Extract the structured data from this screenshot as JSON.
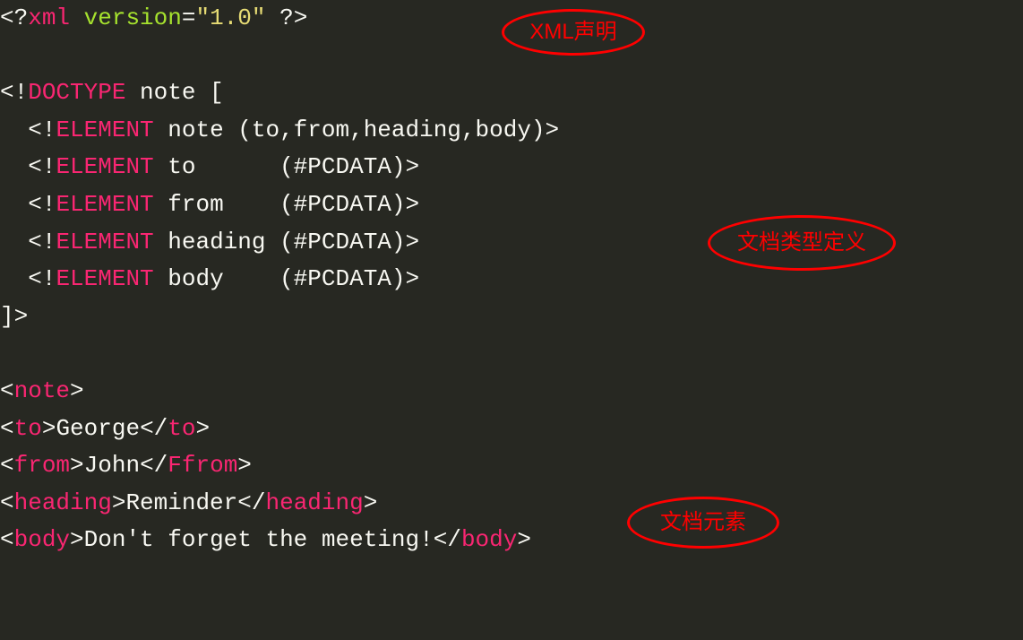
{
  "code": {
    "line1": {
      "open": "<?",
      "keyword": "xml",
      "attr": "version",
      "eq": "=",
      "value": "\"1.0\"",
      "close": " ?>"
    },
    "line2": {
      "open": "<!",
      "keyword": "DOCTYPE",
      "name": " note [",
      "full": "<!DOCTYPE note ["
    },
    "line3": {
      "indent": "  ",
      "open": "<!",
      "keyword": "ELEMENT",
      "rest": " note (to,from,heading,body)>"
    },
    "line4": {
      "indent": "  ",
      "open": "<!",
      "keyword": "ELEMENT",
      "rest": " to      (#PCDATA)>"
    },
    "line5": {
      "indent": "  ",
      "open": "<!",
      "keyword": "ELEMENT",
      "rest": " from    (#PCDATA)>"
    },
    "line6": {
      "indent": "  ",
      "open": "<!",
      "keyword": "ELEMENT",
      "rest": " heading (#PCDATA)>"
    },
    "line7": {
      "indent": "  ",
      "open": "<!",
      "keyword": "ELEMENT",
      "rest": " body    (#PCDATA)>"
    },
    "line8": "]>",
    "line9": {
      "lt": "<",
      "tag": "note",
      "gt": ">"
    },
    "line10": {
      "lt1": "<",
      "tag1": "to",
      "gt1": ">",
      "text": "George",
      "lt2": "</",
      "tag2": "to",
      "gt2": ">"
    },
    "line11": {
      "lt1": "<",
      "tag1": "from",
      "gt1": ">",
      "text": "John",
      "lt2": "</",
      "tag2": "Ffrom",
      "gt2": ">"
    },
    "line12": {
      "lt1": "<",
      "tag1": "heading",
      "gt1": ">",
      "text": "Reminder",
      "lt2": "</",
      "tag2": "heading",
      "gt2": ">"
    },
    "line13": {
      "lt1": "<",
      "tag1": "body",
      "gt1": ">",
      "text": "Don't forget the meeting!",
      "lt2": "</",
      "tag2": "body",
      "gt2": ">"
    }
  },
  "annotations": {
    "a1": "XML声明",
    "a2": "文档类型定义",
    "a3": "文档元素"
  }
}
